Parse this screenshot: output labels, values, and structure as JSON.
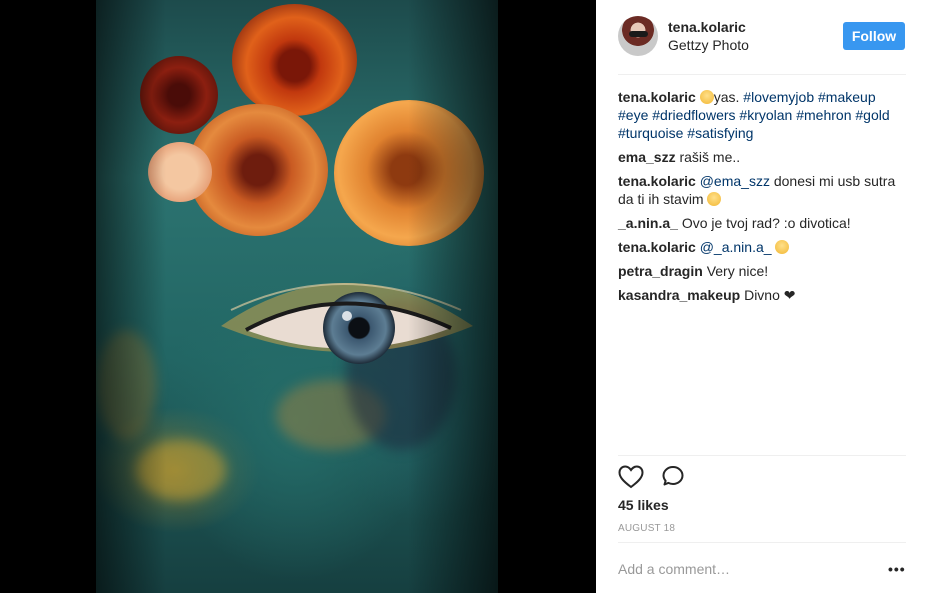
{
  "post": {
    "author": "tena.kolaric",
    "location": "Gettzy Photo",
    "follow_label": "Follow"
  },
  "comments": [
    {
      "author": "tena.kolaric",
      "parts": [
        "yas. "
      ],
      "tags": [
        "#lovemyjob",
        "#makeup",
        "#eye",
        "#driedflowers",
        "#kryolan",
        "#mehron",
        "#gold",
        "#turquoise",
        "#satisfying"
      ]
    },
    {
      "author": "ema_szz",
      "text": "rašiš me.."
    },
    {
      "author": "tena.kolaric",
      "mention": "@ema_szz",
      "text": " donesi mi usb sutra da ti ih stavim"
    },
    {
      "author": "_a.nin.a_",
      "text": "Ovo je tvoj rad? :o divotica!"
    },
    {
      "author": "tena.kolaric",
      "mention": "@_a.nin.a_",
      "text": ""
    },
    {
      "author": "petra_dragin",
      "text": "Very nice!"
    },
    {
      "author": "kasandra_makeup",
      "text": "Divno"
    }
  ],
  "icons": {
    "like": "heart-icon",
    "comment": "comment-icon",
    "more": "more-options-icon",
    "emoji_smirk": "smirk-emoji",
    "emoji_wink": "wink-emoji",
    "emoji_kiss": "kiss-emoji",
    "heart_glyph": "❤"
  },
  "likes": "45 likes",
  "date": "AUGUST 18",
  "add_comment_placeholder": "Add a comment…",
  "more_label": "•••",
  "colors": {
    "follow_button": "#3897f0",
    "hashtag": "#003569",
    "meta": "#999999"
  }
}
